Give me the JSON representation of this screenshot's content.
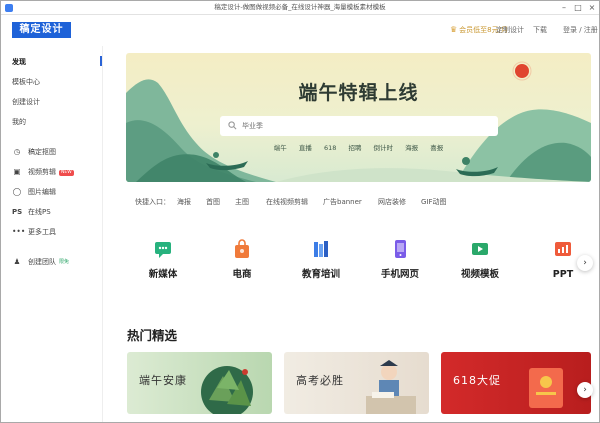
{
  "window": {
    "title": "稿定设计-做图做视频必备_在线设计神器_海量模板素材模板"
  },
  "header": {
    "logo_text": "稿定设计",
    "vip_text": "会员低至8元/月",
    "links": [
      "定制设计",
      "下载",
      "登录 / 注册"
    ]
  },
  "sidebar": {
    "items": [
      {
        "label": "发现",
        "icon": "",
        "active": true
      },
      {
        "label": "模板中心",
        "icon": ""
      },
      {
        "label": "创建设计",
        "icon": ""
      },
      {
        "label": "我的",
        "icon": ""
      },
      {
        "label": "稿定抠图",
        "icon": "cutout-icon"
      },
      {
        "label": "视频剪辑",
        "icon": "video-edit-icon",
        "badge": "NEW"
      },
      {
        "label": "图片编辑",
        "icon": "image-edit-icon"
      },
      {
        "label": "在线PS",
        "icon": "ps-icon"
      },
      {
        "label": "更多工具",
        "icon": "more-dots-icon"
      },
      {
        "label": "创建团队",
        "icon": "team-icon",
        "badge": "限免"
      }
    ]
  },
  "banner": {
    "title": "端午特辑上线",
    "search_placeholder": "毕业季",
    "hot_tags": [
      "端午",
      "直播",
      "618",
      "招聘",
      "倒计时",
      "海报",
      "喜报"
    ]
  },
  "quick_entry": {
    "label": "快捷入口：",
    "items": [
      "海报",
      "首图",
      "主图",
      "在线视频剪辑",
      "广告banner",
      "网店装修",
      "GIF动图"
    ]
  },
  "categories": [
    {
      "label": "新媒体",
      "icon": "new-media-icon",
      "color": "#27b27e"
    },
    {
      "label": "电商",
      "icon": "ecommerce-bag-icon",
      "color": "#f07a3a"
    },
    {
      "label": "教育培训",
      "icon": "education-books-icon",
      "color": "#3c7de6"
    },
    {
      "label": "手机网页",
      "icon": "mobile-page-icon",
      "color": "#7a5ce8"
    },
    {
      "label": "视频模板",
      "icon": "video-template-icon",
      "color": "#2aa86a"
    },
    {
      "label": "PPT",
      "icon": "ppt-icon",
      "color": "#ef5b3b"
    }
  ],
  "hot": {
    "title": "热门精选",
    "cards": [
      {
        "text": "端午安康",
        "bg": "#cfe4c8"
      },
      {
        "text": "高考必胜",
        "bg": "#ece4d8"
      },
      {
        "text": "618大促",
        "bg": "#d72f2f"
      }
    ]
  },
  "colors": {
    "brand": "#1e62d8",
    "vip": "#c8962e"
  }
}
